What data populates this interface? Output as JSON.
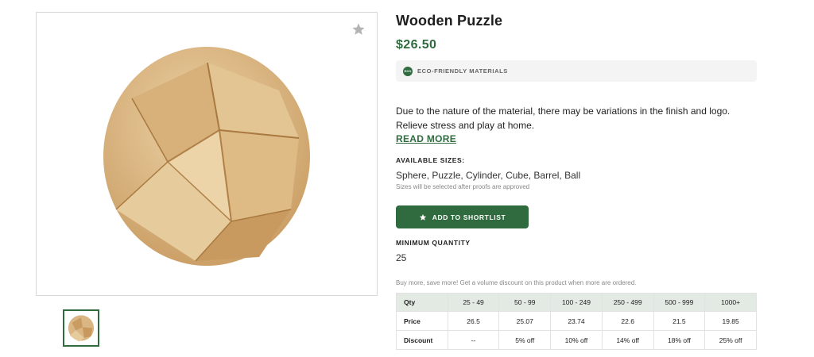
{
  "product": {
    "title": "Wooden Puzzle",
    "price": "$26.50",
    "eco_badge": {
      "icon_text": "ECO",
      "label": "ECO-FRIENDLY MATERIALS"
    },
    "description": "Due to the nature of the material, there may be variations in the finish and logo. Relieve stress and play at home.",
    "read_more": "READ MORE",
    "sizes": {
      "label": "AVAILABLE SIZES:",
      "value": "Sphere, Puzzle, Cylinder, Cube, Barrel, Ball",
      "note": "Sizes will be selected after proofs are approved"
    },
    "shortlist_button": "ADD TO SHORTLIST",
    "minimum_quantity": {
      "label": "MINIMUM QUANTITY",
      "value": "25"
    },
    "volume_note": "Buy more, save more! Get a volume discount on this product when more are ordered."
  },
  "pricing_table": {
    "headers": [
      "Qty",
      "25 - 49",
      "50 - 99",
      "100 - 249",
      "250 - 499",
      "500 - 999",
      "1000+"
    ],
    "rows": [
      [
        "Price",
        "26.5",
        "25.07",
        "23.74",
        "22.6",
        "21.5",
        "19.85"
      ],
      [
        "Discount",
        "--",
        "5% off",
        "10% off",
        "14% off",
        "18% off",
        "25% off"
      ]
    ]
  },
  "icons": {
    "favorite": "star-icon",
    "shortlist": "star-icon",
    "eco": "eco-leaf-icon"
  },
  "colors": {
    "brand_green": "#2f6b3e",
    "table_header_bg": "#e3e9e3",
    "wood": "#d9b684"
  }
}
